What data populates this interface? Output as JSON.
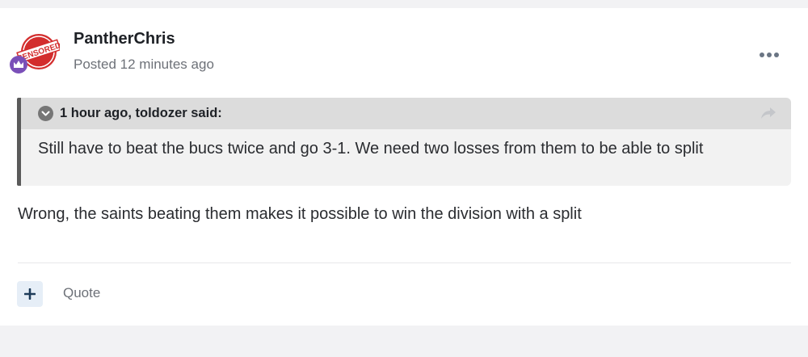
{
  "post": {
    "author": {
      "name": "PantherChris",
      "avatar_badge_text": "CENSORED",
      "rank_icon": "crown-badge-icon"
    },
    "posted_label": "Posted 12 minutes ago",
    "menu_icon": "more-options-icon",
    "quote": {
      "citation": "1 hour ago, toldozer said:",
      "text": "Still have to beat the bucs twice and go 3-1.  We need two losses from them to be able to split",
      "collapse_icon": "chevron-down-icon",
      "share_icon": "share-arrow-icon"
    },
    "content": "Wrong, the saints beating them makes it possible to win the division with a split",
    "actions": {
      "react_icon": "plus-icon",
      "quote_label": "Quote"
    }
  },
  "colors": {
    "accent": "#1e3c5a",
    "quote_border": "#5a5a5a",
    "badge_red": "#d32d2d",
    "rank_purple": "#7a4fb8"
  }
}
